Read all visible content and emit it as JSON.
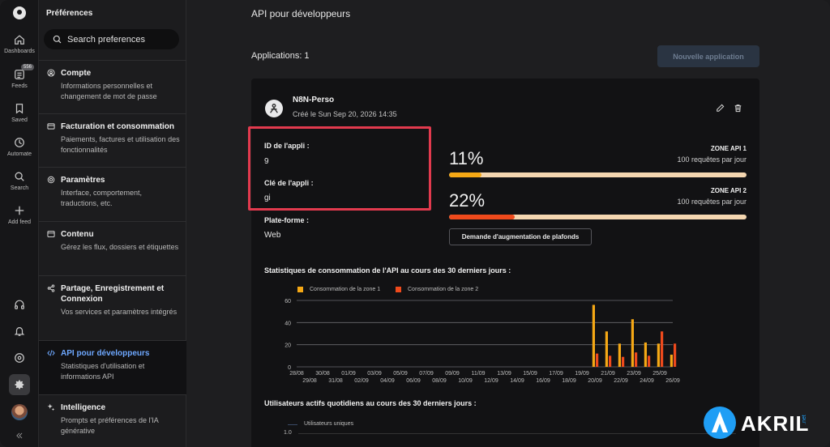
{
  "rail": {
    "items": [
      {
        "label": "Dashboards",
        "icon": "home-icon"
      },
      {
        "label": "Feeds",
        "icon": "feeds-icon",
        "badge": "556"
      },
      {
        "label": "Saved",
        "icon": "bookmark-icon"
      },
      {
        "label": "Automate",
        "icon": "automate-icon"
      },
      {
        "label": "Search",
        "icon": "search-icon"
      },
      {
        "label": "Add feed",
        "icon": "plus-icon"
      }
    ]
  },
  "sidebar": {
    "title": "Préférences",
    "search_placeholder": "Search preferences",
    "items": [
      {
        "title": "Compte",
        "desc": "Informations personnelles et changement de mot de passe",
        "icon": "user-circle-icon"
      },
      {
        "title": "Facturation et consommation",
        "desc": "Paiements, factures et utilisation des fonctionnalités",
        "icon": "credit-card-icon"
      },
      {
        "title": "Paramètres",
        "desc": "Interface, comportement, traductions, etc.",
        "icon": "gear-icon"
      },
      {
        "title": "Contenu",
        "desc": "Gérez les flux, dossiers et étiquettes",
        "icon": "folder-icon"
      },
      {
        "title": "Partage, Enregistrement et Connexion",
        "desc": "Vos services et paramètres intégrés",
        "icon": "share-icon"
      },
      {
        "title": "API pour développeurs",
        "desc": "Statistiques d'utilisation et informations API",
        "icon": "code-icon"
      },
      {
        "title": "Intelligence",
        "desc": "Prompts et préférences de l'IA générative",
        "icon": "sparkle-icon"
      }
    ]
  },
  "main": {
    "title": "API pour développeurs",
    "apps_count": "Applications: 1",
    "new_app_label": "Nouvelle application",
    "app": {
      "name": "N8N-Perso",
      "created": "Créé le Sun Sep 20, 2026 14:35",
      "id_label": "ID de l'appli :",
      "id_value": "9",
      "key_label": "Clé de l'appli :",
      "key_value": "gi",
      "platform_label": "Plate-forme :",
      "platform_value": "Web"
    },
    "zones": [
      {
        "percent": "11%",
        "value": 11,
        "title": "ZONE API 1",
        "subtitle": "100 requêtes par jour",
        "color": "#f5a815"
      },
      {
        "percent": "22%",
        "value": 22,
        "title": "ZONE API 2",
        "subtitle": "100 requêtes par jour",
        "color": "#ef4a1c"
      }
    ],
    "raise_button": "Demande d'augmentation de plafonds",
    "stats_title": "Statistiques de consommation de l'API au cours des 30 derniers jours :",
    "dau_title": "Utilisateurs actifs quotidiens au cours des 30 derniers jours :"
  },
  "chart_data": [
    {
      "type": "bar",
      "title": "",
      "categories": [
        "28/08",
        "29/08",
        "30/08",
        "31/08",
        "01/09",
        "02/09",
        "03/09",
        "04/09",
        "05/09",
        "06/09",
        "07/09",
        "08/09",
        "09/09",
        "10/09",
        "11/09",
        "12/09",
        "13/09",
        "14/09",
        "15/09",
        "16/09",
        "17/09",
        "18/09",
        "19/09",
        "20/09",
        "21/09",
        "22/09",
        "23/09",
        "24/09",
        "25/09",
        "26/09"
      ],
      "series": [
        {
          "name": "Consommation de la zone 1",
          "color": "#f5a815",
          "values": [
            0,
            0,
            0,
            0,
            0,
            0,
            0,
            0,
            0,
            0,
            0,
            0,
            0,
            0,
            0,
            0,
            0,
            0,
            0,
            0,
            0,
            0,
            0,
            56,
            32,
            21,
            43,
            22,
            21,
            11
          ]
        },
        {
          "name": "Consommation de la zone 2",
          "color": "#ef4a1c",
          "values": [
            0,
            0,
            0,
            0,
            0,
            0,
            0,
            0,
            0,
            0,
            0,
            0,
            0,
            0,
            0,
            0,
            0,
            0,
            0,
            0,
            0,
            0,
            0,
            12,
            10,
            9,
            13,
            10,
            32,
            21
          ]
        }
      ],
      "ylim": [
        0,
        60
      ],
      "yticks": [
        0,
        20,
        40,
        60
      ],
      "grid": true,
      "legend": "top-left"
    },
    {
      "type": "line",
      "title": "",
      "series": [
        {
          "name": "Utilisateurs uniques",
          "values": []
        }
      ],
      "yticks": [
        "1.0"
      ],
      "legend": "top-left"
    }
  ]
}
